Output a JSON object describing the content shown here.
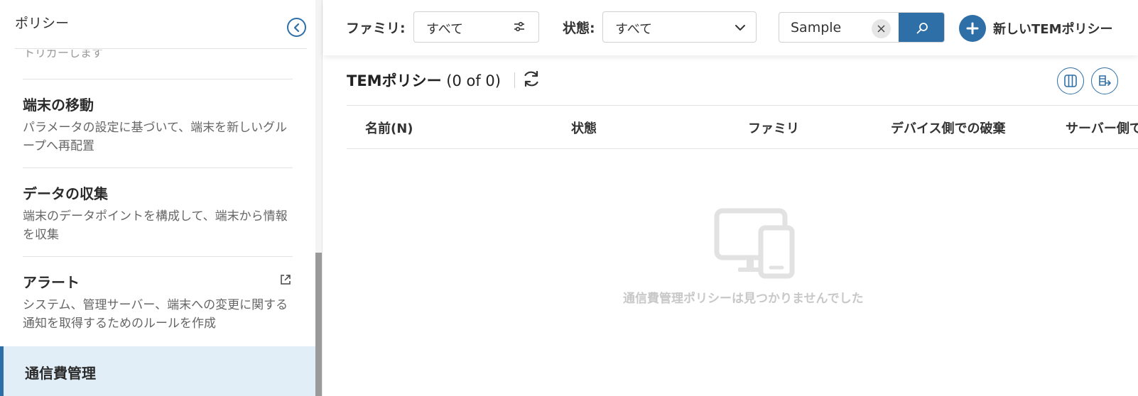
{
  "sidebar": {
    "title": "ポリシー",
    "cutoff_text": "トリガーします",
    "items": [
      {
        "title": "端末の移動",
        "desc": "パラメータの設定に基づいて、端末を新しいグループへ再配置"
      },
      {
        "title": "データの収集",
        "desc": "端末のデータポイントを構成して、端末から情報を収集"
      },
      {
        "title": "アラート",
        "desc": "システム、管理サーバー、端末への変更に関する通知を取得するためのルールを作成"
      }
    ],
    "selected": "通信費管理"
  },
  "filters": {
    "family_label": "ファミリ:",
    "family_value": "すべて",
    "status_label": "状態:",
    "status_value": "すべて",
    "search_value": "Sample"
  },
  "new_button_label": "新しいTEMポリシー",
  "content": {
    "title": "TEMポリシー",
    "count": "(0 of 0)"
  },
  "table": {
    "columns": [
      "名前(N)",
      "状態",
      "ファミリ",
      "デバイス側での破棄",
      "サーバー側で"
    ]
  },
  "empty_message": "通信費管理ポリシーは見つかりませんでした",
  "colors": {
    "accent": "#2e6fa8",
    "selected_bg": "#e1eef7"
  },
  "icons": [
    "chevron-left-icon",
    "external-link-icon",
    "sliders-icon",
    "chevron-down-icon",
    "close-icon",
    "search-icon",
    "plus-icon",
    "refresh-icon",
    "columns-icon",
    "export-icon",
    "devices-icon"
  ]
}
